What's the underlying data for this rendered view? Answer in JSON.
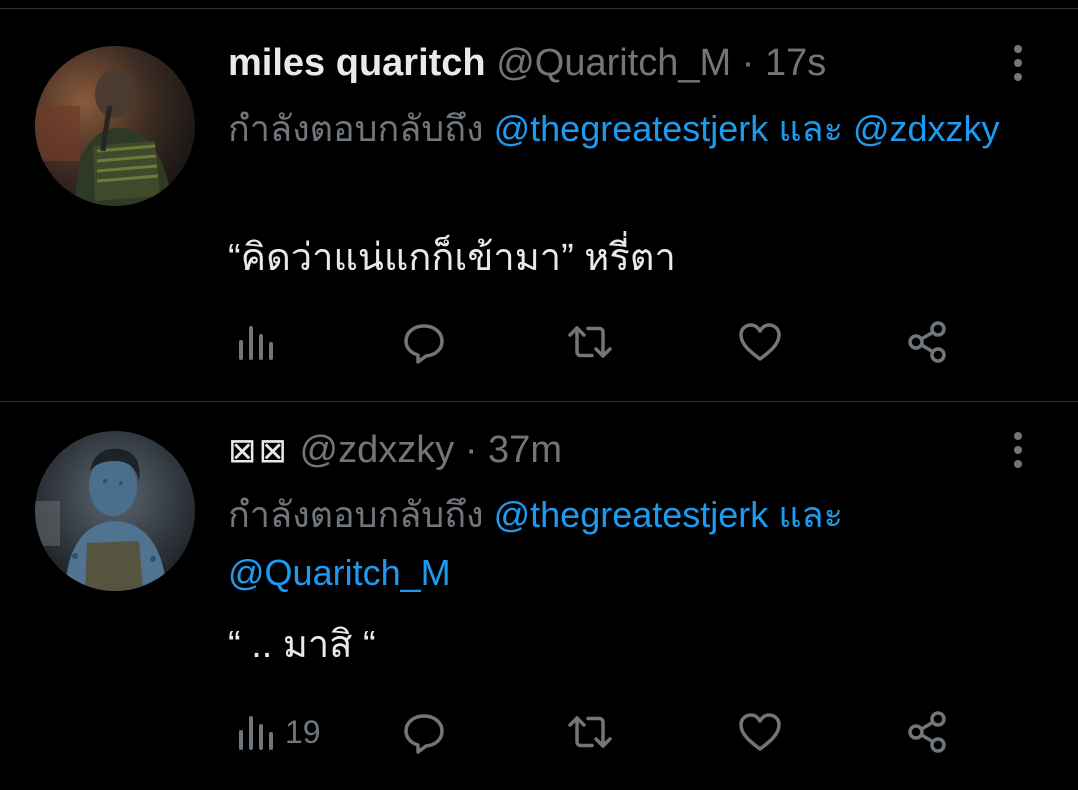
{
  "tweets": [
    {
      "name": "miles quaritch",
      "handle": "@Quaritch_M",
      "separator": "·",
      "time": "17s",
      "reply_prefix": "กำลังตอบกลับถึง",
      "reply_to": [
        "@thegreatestjerk",
        "@zdxzky"
      ],
      "reply_joiner": "และ",
      "text": "“คิดว่าแน่แกก็เข้ามา” หรี่ตา",
      "views": ""
    },
    {
      "name": "⊠⊠",
      "handle": "@zdxzky",
      "separator": "·",
      "time": "37m",
      "reply_prefix": "กำลังตอบกลับถึง",
      "reply_to": [
        "@thegreatestjerk",
        "@Quaritch_M"
      ],
      "reply_joiner": "และ",
      "text": "“ .. มาสิ “",
      "views": "19"
    }
  ],
  "icons": {
    "views": "bar-chart-icon",
    "reply": "speech-bubble-icon",
    "retweet": "retweet-icon",
    "like": "heart-icon",
    "share": "share-icon",
    "more": "more-vertical-icon"
  },
  "colors": {
    "background": "#000000",
    "text": "#e7e9ea",
    "secondary": "#71767b",
    "link": "#1d9bf0",
    "divider": "#2f3336"
  }
}
